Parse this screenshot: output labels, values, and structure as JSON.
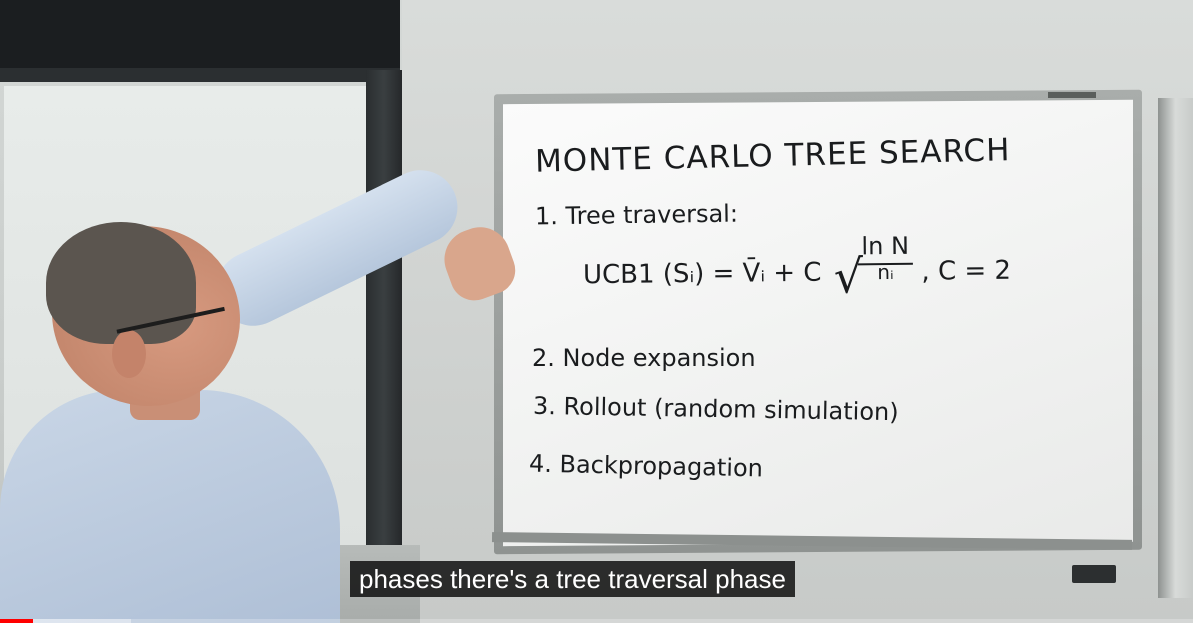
{
  "whiteboard": {
    "title": "MONTE CARLO TREE SEARCH",
    "step1": "1. Tree traversal:",
    "formula_lhs": "UCB1 (Sᵢ) = V̄ᵢ + C",
    "formula_num": "ln N",
    "formula_den": "nᵢ",
    "formula_const": ",  C = 2",
    "step2": "2. Node expansion",
    "step3": "3. Rollout (random simulation)",
    "step4": "4. Backpropagation"
  },
  "caption": {
    "text": "phases there's a tree traversal phase"
  },
  "player": {
    "progress_fraction": 0.028,
    "buffer_fraction": 0.11,
    "accent_color": "#ff0000"
  }
}
